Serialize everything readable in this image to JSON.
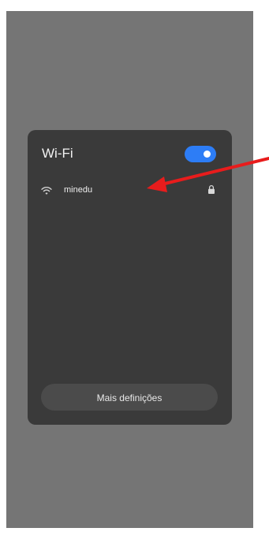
{
  "wifi_panel": {
    "title": "Wi-Fi",
    "toggle_on": true,
    "accent_color": "#2d7df6",
    "networks": [
      {
        "name": "minedu",
        "icon": "wifi-signal-icon",
        "secured_icon": "lock-icon"
      }
    ],
    "more_settings_label": "Mais definições"
  },
  "annotation": {
    "icon": "arrow-icon",
    "color": "#e81c1c"
  }
}
